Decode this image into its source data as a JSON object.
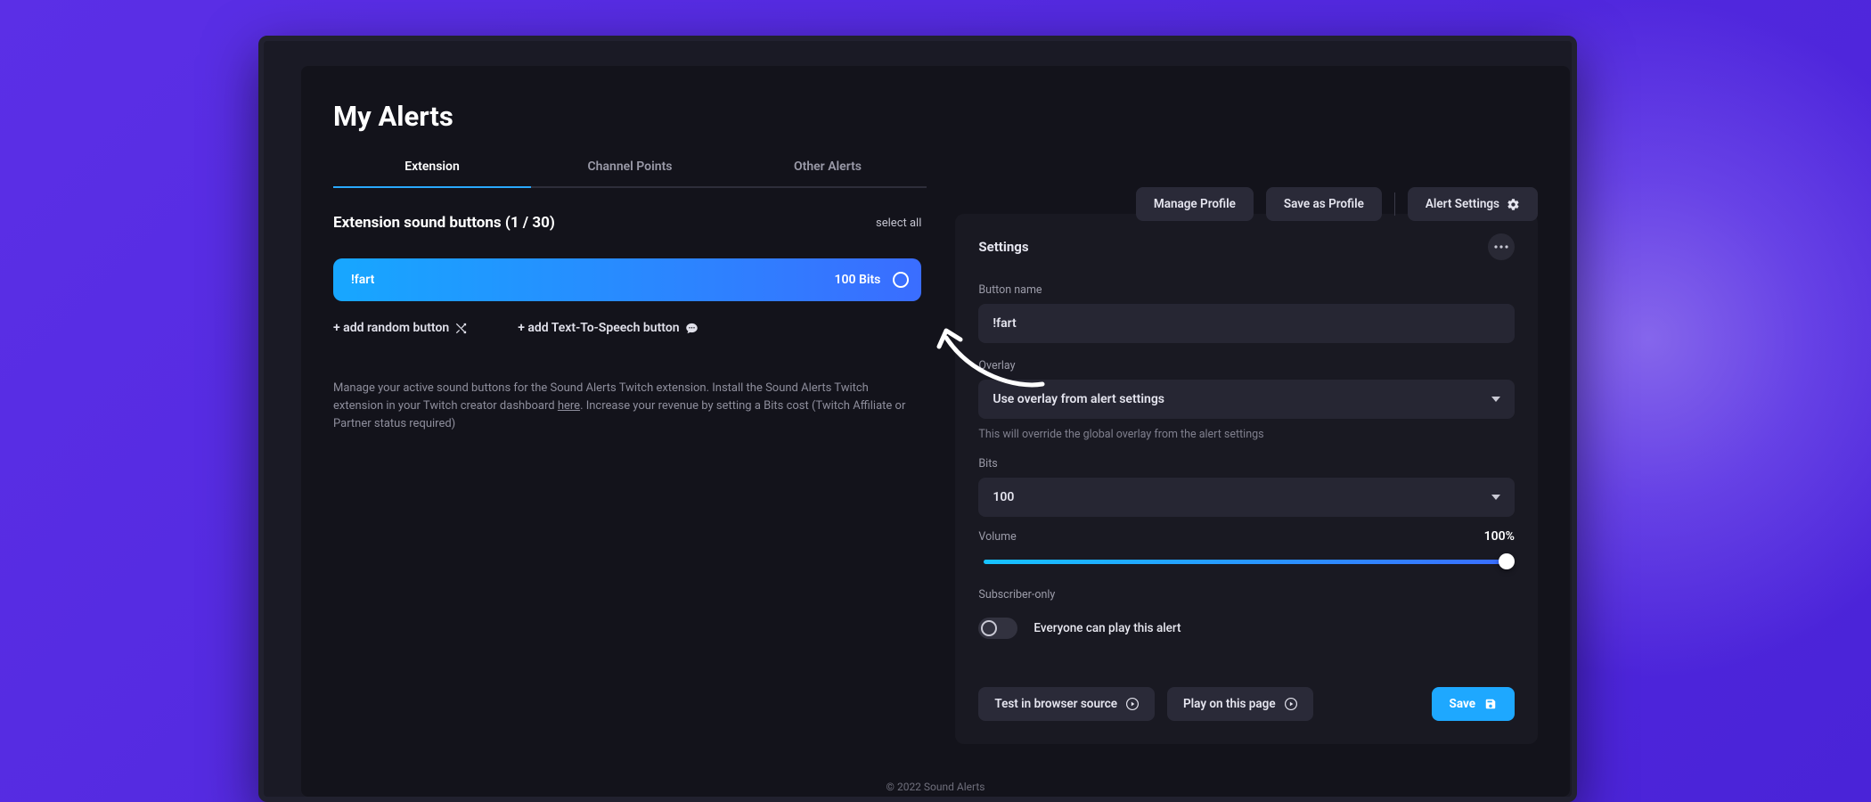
{
  "page_title": "My Alerts",
  "tabs": [
    "Extension",
    "Channel Points",
    "Other Alerts"
  ],
  "active_tab": 0,
  "actions": {
    "manage_profile": "Manage Profile",
    "save_as_profile": "Save as Profile",
    "alert_settings": "Alert Settings"
  },
  "left": {
    "heading": "Extension sound buttons (1 / 30)",
    "select_all": "select all",
    "sound_button": {
      "name": "!fart",
      "cost": "100 Bits"
    },
    "add_random": "+ add random button",
    "add_tts": "+ add Text-To-Speech button",
    "help_1": "Manage your active sound buttons for the Sound Alerts Twitch extension. Install the Sound Alerts Twitch extension in your Twitch creator dashboard ",
    "help_link": "here",
    "help_2": ". Increase your revenue by setting a Bits cost (Twitch Affiliate or Partner status required)"
  },
  "panel": {
    "title": "Settings",
    "button_name_label": "Button name",
    "button_name_value": "!fart",
    "overlay_label": "Overlay",
    "overlay_value": "Use overlay from alert settings",
    "overlay_hint": "This will override the global overlay from the alert settings",
    "bits_label": "Bits",
    "bits_value": "100",
    "volume_label": "Volume",
    "volume_value": "100%",
    "sub_label": "Subscriber-only",
    "sub_text": "Everyone can play this alert",
    "test_label": "Test in browser source",
    "play_label": "Play on this page",
    "save_label": "Save"
  },
  "footer": "© 2022 Sound Alerts"
}
